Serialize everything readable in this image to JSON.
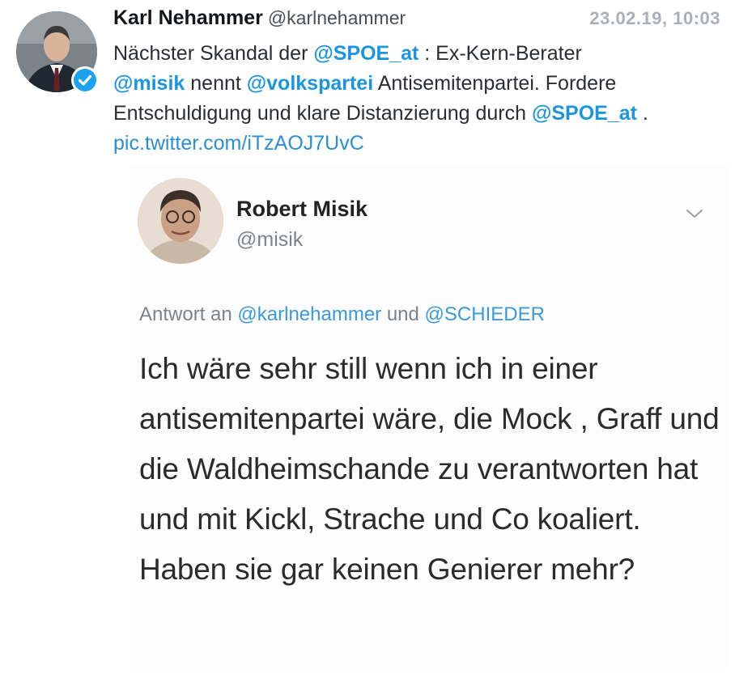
{
  "tweet": {
    "author_name": "Karl Nehammer",
    "author_handle": "@karlnehammer",
    "timestamp": "23.02.19, 10:03",
    "text": {
      "part1": "Nächster Skandal der ",
      "mention1": "@SPOE_at",
      "part2": " : Ex-Kern-Berater ",
      "mention2": "@misik",
      "part3": " nennt ",
      "mention3": "@volkspartei",
      "part4": " Antisemitenpartei. Fordere Entschuldigung und klare Distanzierung durch ",
      "mention4": "@SPOE_at",
      "part5": " . ",
      "link": "pic.twitter.com/iTzAOJ7UvC"
    },
    "icons": {
      "avatar": "avatar-photo",
      "verified": "verified-badge-icon"
    },
    "colors": {
      "mention": "#1b95e0",
      "verified": "#1da1f2"
    }
  },
  "embedded": {
    "author_name": "Robert Misik",
    "author_handle": "@misik",
    "reply_prefix": "Antwort an ",
    "reply_mention1": "@karlnehammer",
    "reply_and": " und ",
    "reply_mention2": "@SCHIEDER",
    "body": "Ich wäre sehr still wenn ich in einer antisemitenpartei wäre, die Mock , Graff und die Waldheimschande zu verantworten hat und mit Kickl, Strache und Co koaliert. Haben sie gar keinen Genierer mehr?",
    "icons": {
      "menu": "chevron-down-icon"
    }
  }
}
